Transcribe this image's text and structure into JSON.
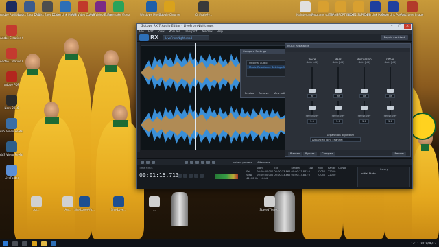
{
  "desktop": {
    "icons_top_row": [
      {
        "label": "Adobe Audition CC",
        "color": "#1e2b5e"
      },
      {
        "label": "Rocks Easy DVD to DVD",
        "color": "#3d5b8c"
      },
      {
        "label": "Rocks Easy DL to MP3",
        "color": "#4e4e4e"
      },
      {
        "label": "CyberLink Media Suite",
        "color": "#2d6fb6"
      },
      {
        "label": "AVS Video Converter",
        "color": "#c13a2b"
      },
      {
        "label": "AVS Video Editor",
        "color": "#7a2b86"
      },
      {
        "label": "Freemake Video",
        "color": "#2ba35a"
      },
      {
        "label": "Windows Movie Maker",
        "color": "#1f5fa8"
      },
      {
        "label": "Google Chrome",
        "color": "#d9a21c"
      },
      {
        "label": "OhYeahMy...",
        "color": "#3a3a3a"
      },
      {
        "label": "Maintenance",
        "color": "#e0e0e0"
      },
      {
        "label": "Programs still to install",
        "color": "#d8a030"
      },
      {
        "label": "TRANSPORT BOOKMARKS",
        "color": "#d8a030"
      },
      {
        "label": "BOXE2 SUPPORT",
        "color": "#d8a030"
      },
      {
        "label": "CyberLink PowerDVD 15",
        "color": "#1f3f9e"
      },
      {
        "label": "CyberLink PowerDVD 15 ...",
        "color": "#1f3f9e"
      },
      {
        "label": "FastStone Image Viewer",
        "color": "#b23a2a"
      }
    ],
    "icons_left_col": [
      {
        "label": "Adobe Creative Cloud",
        "color": "#c43a2f"
      },
      {
        "label": "Adobe Creative Product...",
        "color": "#c43a2f"
      },
      {
        "label": "Adobe PDF",
        "color": "#b3261e"
      },
      {
        "label": "Nero 2016",
        "color": "#2a2a2a"
      },
      {
        "label": "AVS Video ReMaker",
        "color": "#3a6ea5"
      },
      {
        "label": "AVS Video ReMaker",
        "color": "#2e5f8a"
      },
      {
        "label": "LiveFolder",
        "color": "#5b8fd6"
      }
    ],
    "icons_bottom_row": [
      {
        "label": "Aa...",
        "color": "#d0d0d0"
      },
      {
        "label": "Aa...",
        "color": "#d0d0d0"
      },
      {
        "label": "She-Loves-Yo...",
        "color": "#1d4f91"
      },
      {
        "label": "She-Love...",
        "color": "#1d4f91"
      },
      {
        "label": "...",
        "color": "#d0d0d0"
      },
      {
        "label": "StayedThere...",
        "color": "#d0d0d0"
      }
    ],
    "logo_text": "CRICKET AUSTRALIA"
  },
  "window": {
    "title": "iZotope RX 7 Audio Editor - LiveFromNight.mp4",
    "menu": [
      "File",
      "Edit",
      "View",
      "Modules",
      "Transport",
      "Window",
      "Help"
    ],
    "app_name": "RX",
    "file_tab": "LiveFromNight.mp4",
    "repair_assistant": "Repair Assistant",
    "compare_dialog": {
      "title": "Compare Settings",
      "items": [
        "Original audio",
        "Music Rebalance Settings 1"
      ],
      "buttons": [
        "Preview",
        "Remove",
        "View settings",
        "Render"
      ]
    },
    "rebalance_dialog": {
      "title": "Music Rebalance",
      "columns": [
        {
          "name": "Voice",
          "sub": "Gain [dB]",
          "value": "Inf",
          "sens_value": "5.0"
        },
        {
          "name": "Bass",
          "sub": "Gain [dB]",
          "value": "Inf",
          "sens_value": "5.0"
        },
        {
          "name": "Percussion",
          "sub": "Gain [dB]",
          "value": "Inf",
          "sens_value": "5.0"
        },
        {
          "name": "Other",
          "sub": "Gain [dB]",
          "value": "Inf",
          "sens_value": "5.0"
        }
      ],
      "sensitivity_label": "Sensitivity",
      "separation_label": "Separation algorithm",
      "separation_value": "Advanced joint channel",
      "footer": {
        "preview": "Preview",
        "bypass": "Bypass",
        "compare": "Compare",
        "render": "Render"
      }
    },
    "toolbar": {
      "instant_process": "Instant process",
      "attenuate": "Attenuate"
    },
    "transport": {
      "time_label": "Time h:m:s",
      "timecode": "00:01:15.713",
      "info_headers": [
        "",
        "Start",
        "End",
        "Length",
        "Low",
        "High",
        "Range",
        "Cursor"
      ],
      "info_sel": [
        "Sel",
        "00:00:00.000",
        "00:00:13.862",
        "00:00:13.862",
        "0",
        "22050",
        "22050",
        ""
      ],
      "info_view": [
        "View",
        "00:00:00.000",
        "00:00:13.862",
        "00:00:13.862",
        "0",
        "22050",
        "22050",
        ""
      ],
      "format": "44100 Hz | 16-bit",
      "history_title": "History",
      "history_item": "Initial State"
    }
  },
  "taskbar": {
    "time": "13:11",
    "date": "2019/06/22"
  }
}
